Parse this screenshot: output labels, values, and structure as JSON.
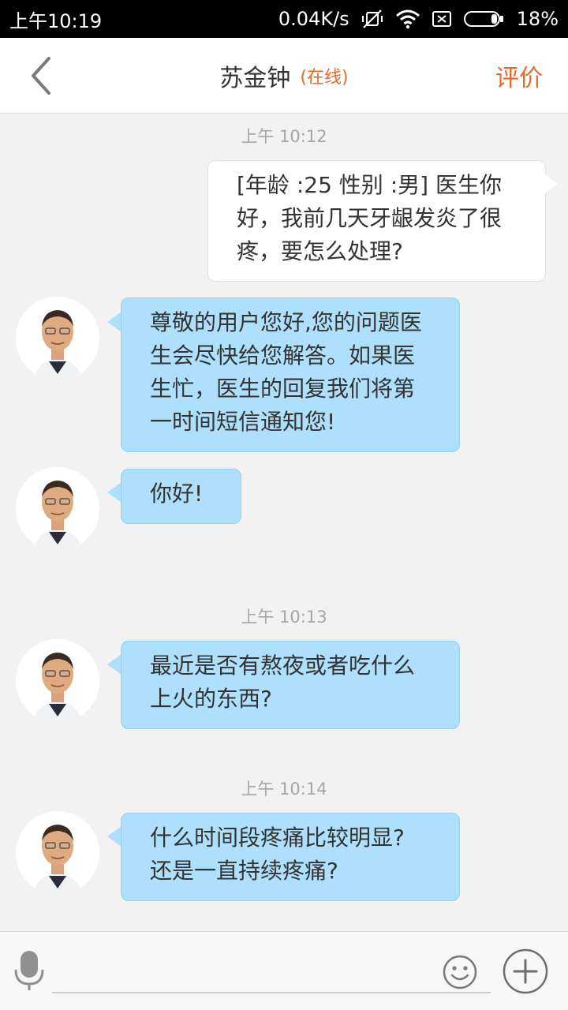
{
  "status_bar": {
    "time": "上午10:19",
    "speed": "0.04K/s",
    "battery": "18%",
    "icons": [
      "mute-vibrate-icon",
      "wifi-icon",
      "sim-icon",
      "battery-icon"
    ]
  },
  "header": {
    "doctor_name": "苏金钟",
    "status": "(在线)",
    "rate_label": "评价",
    "back_icon": "chevron-left-icon"
  },
  "messages": {
    "ts1": "上午 10:12",
    "user_msg": "[年龄 :25 性别 :男]  医生你好，我前几天牙龈发炎了很疼，要怎么处理?",
    "auto_reply": "尊敬的用户您好,您的问题医生会尽快给您解答。如果医生忙，医生的回复我们将第一时间短信通知您!",
    "hello": "你好!",
    "ts2": "上午 10:13",
    "question1": "最近是否有熬夜或者吃什么上火的东西?",
    "ts3": "上午 10:14",
    "question2": "什么时间段疼痛比较明显? 还是一直持续疼痛?"
  },
  "input_bar": {
    "placeholder": "",
    "icons": [
      "microphone-icon",
      "emoji-icon",
      "plus-icon"
    ]
  },
  "colors": {
    "accent": "#e8692a",
    "doctor_bubble": "#aee0fb",
    "user_bubble": "#ffffff",
    "background": "#f2f2f2"
  }
}
